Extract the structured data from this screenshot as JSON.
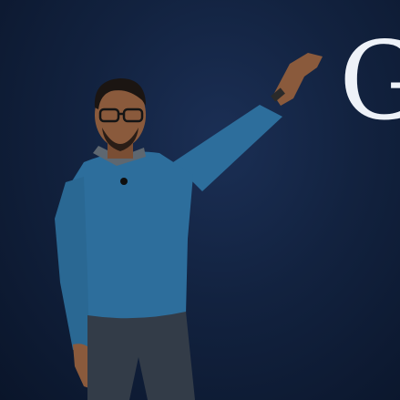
{
  "scene": {
    "background_color": "#12223f",
    "screen_text": "G",
    "sweater_color": "#2d6e9c",
    "jeans_color": "#333c48",
    "skin_color": "#8a5a3c"
  }
}
